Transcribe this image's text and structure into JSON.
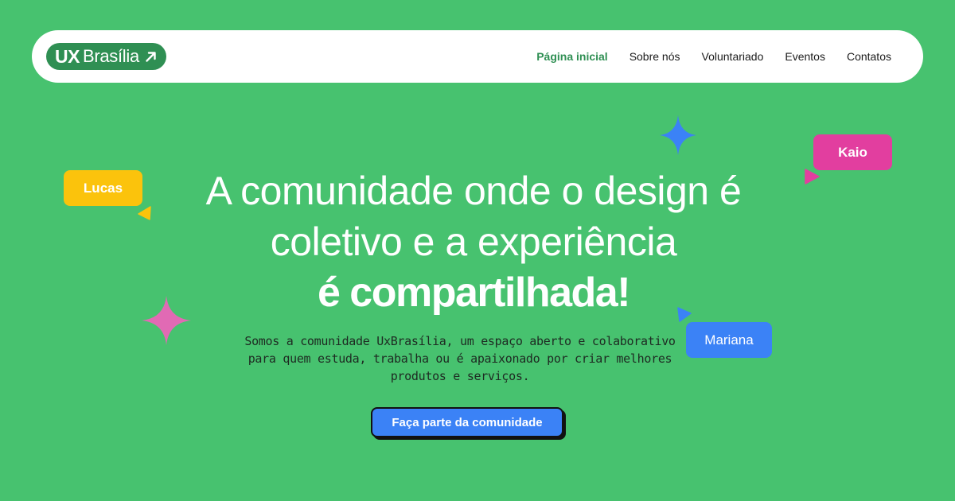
{
  "navbar": {
    "logo": {
      "ux": "UX",
      "brasilia": "Brasília",
      "arrow_icon": "arrow-up-right-icon"
    },
    "links": [
      {
        "label": "Página inicial",
        "active": true
      },
      {
        "label": "Sobre nós",
        "active": false
      },
      {
        "label": "Voluntariado",
        "active": false
      },
      {
        "label": "Eventos",
        "active": false
      },
      {
        "label": "Contatos",
        "active": false
      }
    ]
  },
  "hero": {
    "title_line1": "A comunidade onde o design é",
    "title_line2": "coletivo e a experiência",
    "title_line3": "é compartilhada!",
    "description": "Somos a comunidade UxBrasília, um espaço aberto e colaborativo para quem estuda, trabalha ou é apaixonado por criar melhores produtos e serviços.",
    "cta_label": "Faça parte da comunidade"
  },
  "tags": {
    "lucas": {
      "label": "Lucas",
      "color": "#fbc30c"
    },
    "kaio": {
      "label": "Kaio",
      "color": "#e23e9f"
    },
    "mariana": {
      "label": "Mariana",
      "color": "#3b82f6"
    }
  },
  "decorations": {
    "sparkle_blue": {
      "icon": "four-point-star-icon",
      "color": "#3b82f6"
    },
    "sparkle_pink": {
      "icon": "four-point-star-icon",
      "color": "#e16ab4"
    }
  },
  "colors": {
    "background": "#47c26f",
    "brand_green": "#2f8f53",
    "cta_blue": "#3b82f6"
  }
}
